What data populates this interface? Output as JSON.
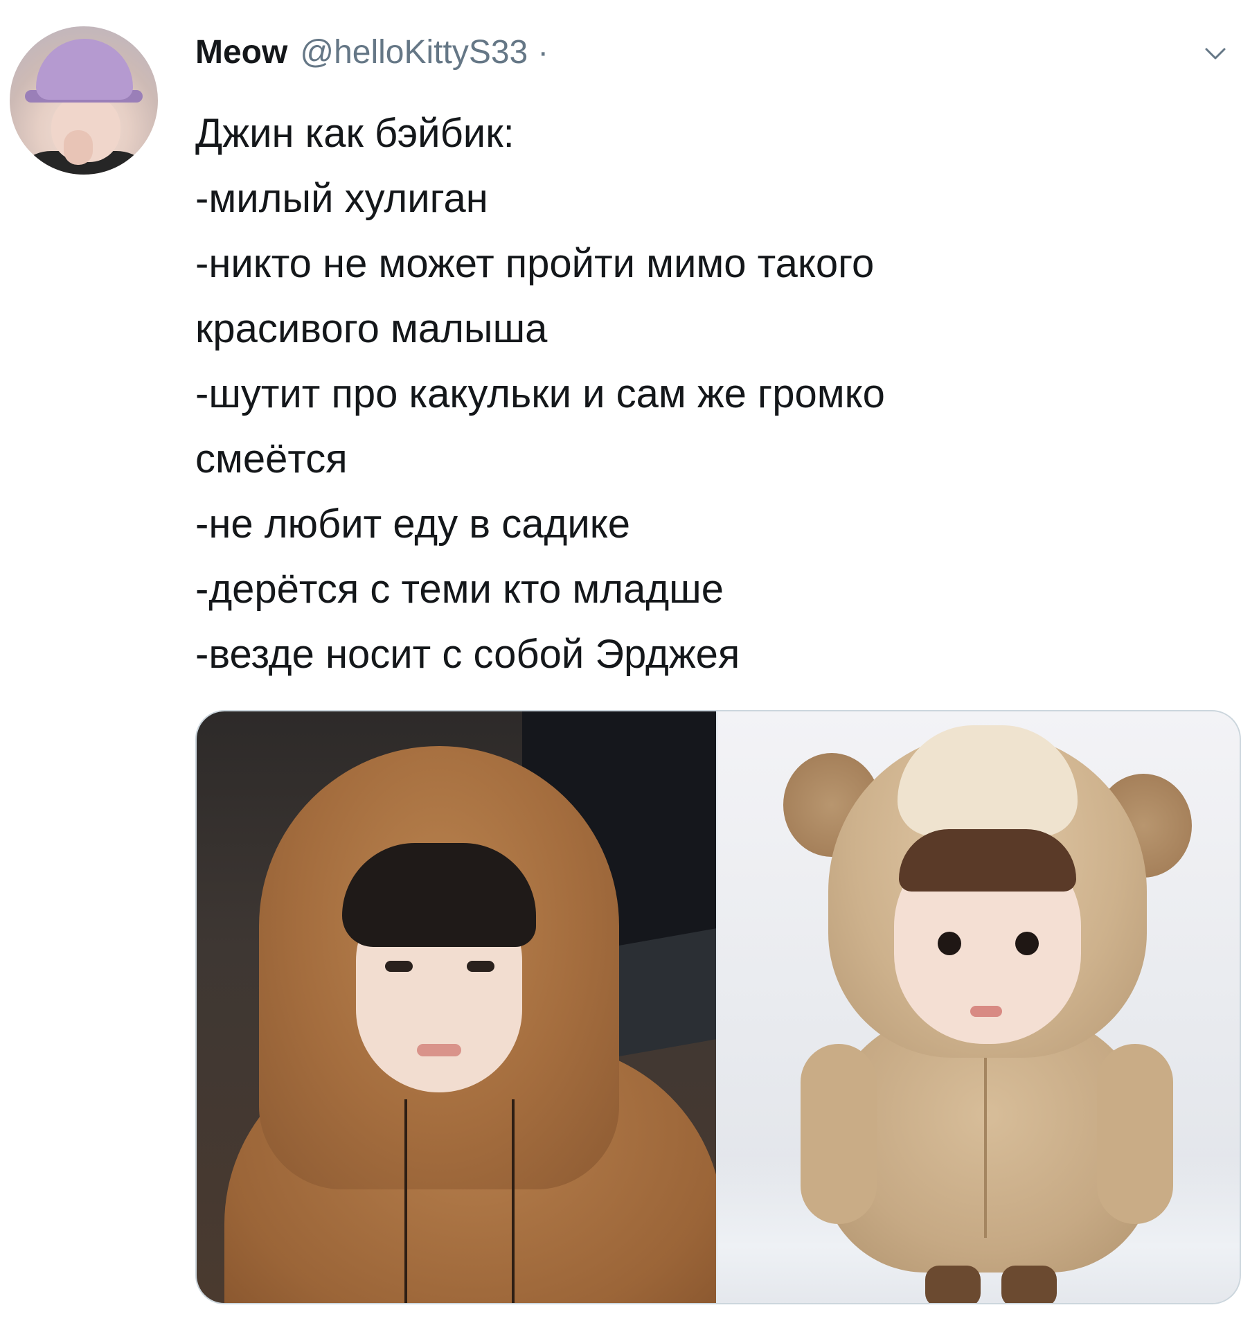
{
  "tweet": {
    "author": {
      "display_name": "Meow",
      "handle": "@helloKittyS33",
      "separator": "·"
    },
    "menu_icon": "chevron-down-icon",
    "text_lines": [
      "Джин как бэйбик:",
      "-милый хулиган",
      "-никто не может пройти мимо такого",
      "красивого малыша",
      "-шутит про какульки и сам же громко",
      "смеётся",
      "-не любит еду в садике",
      "-дерётся с теми кто младше",
      "-везде носит с собой Эрджея"
    ],
    "media_count": 2
  },
  "colors": {
    "text_primary": "#14171a",
    "text_secondary": "#657786",
    "border": "#ccd6dd"
  }
}
